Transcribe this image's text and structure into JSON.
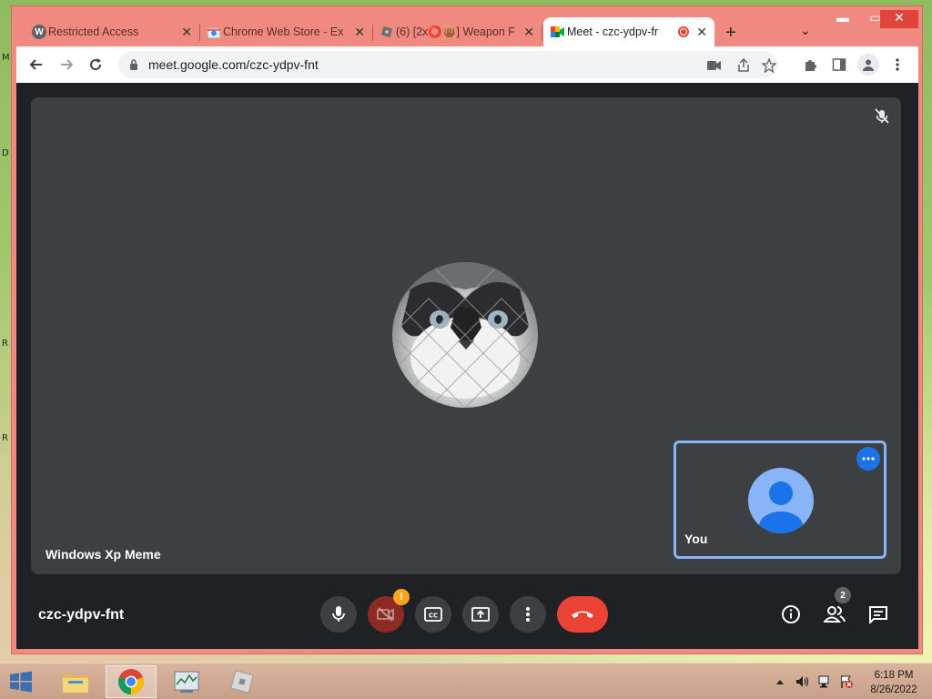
{
  "browser": {
    "tabs": [
      {
        "label": "Restricted Access",
        "favicon": "w-letter-icon",
        "favicon_text": "W",
        "favicon_color": "#5f6368",
        "active": false
      },
      {
        "label": "Chrome Web Store - Ex",
        "favicon": "chrome-web-store-icon",
        "active": false
      },
      {
        "label": "(6) [2x⭕👜] Weapon F",
        "favicon": "roblox-icon",
        "active": false
      },
      {
        "label": "Meet - czc-ydpv-fnt",
        "favicon": "google-meet-icon",
        "active": true,
        "recording": true
      }
    ],
    "url": "meet.google.com/czc-ydpv-fnt",
    "frame_color": "#f08a80"
  },
  "meet": {
    "participant_name": "Windows Xp Meme",
    "self_label": "You",
    "meeting_code": "czc-ydpv-fnt",
    "camera_warning": "!",
    "people_count": "2",
    "colors": {
      "background": "#202124",
      "tile": "#3c4043",
      "hangup": "#ea4335",
      "self_border": "#8ab4f8"
    }
  },
  "taskbar": {
    "clock_time": "6:18 PM",
    "clock_date": "8/26/2022",
    "apps": [
      "file-explorer-icon",
      "chrome-icon",
      "task-manager-icon",
      "roblox-icon"
    ]
  },
  "desktop": {
    "edge_letters": [
      "M",
      "D",
      "R",
      "R"
    ]
  }
}
